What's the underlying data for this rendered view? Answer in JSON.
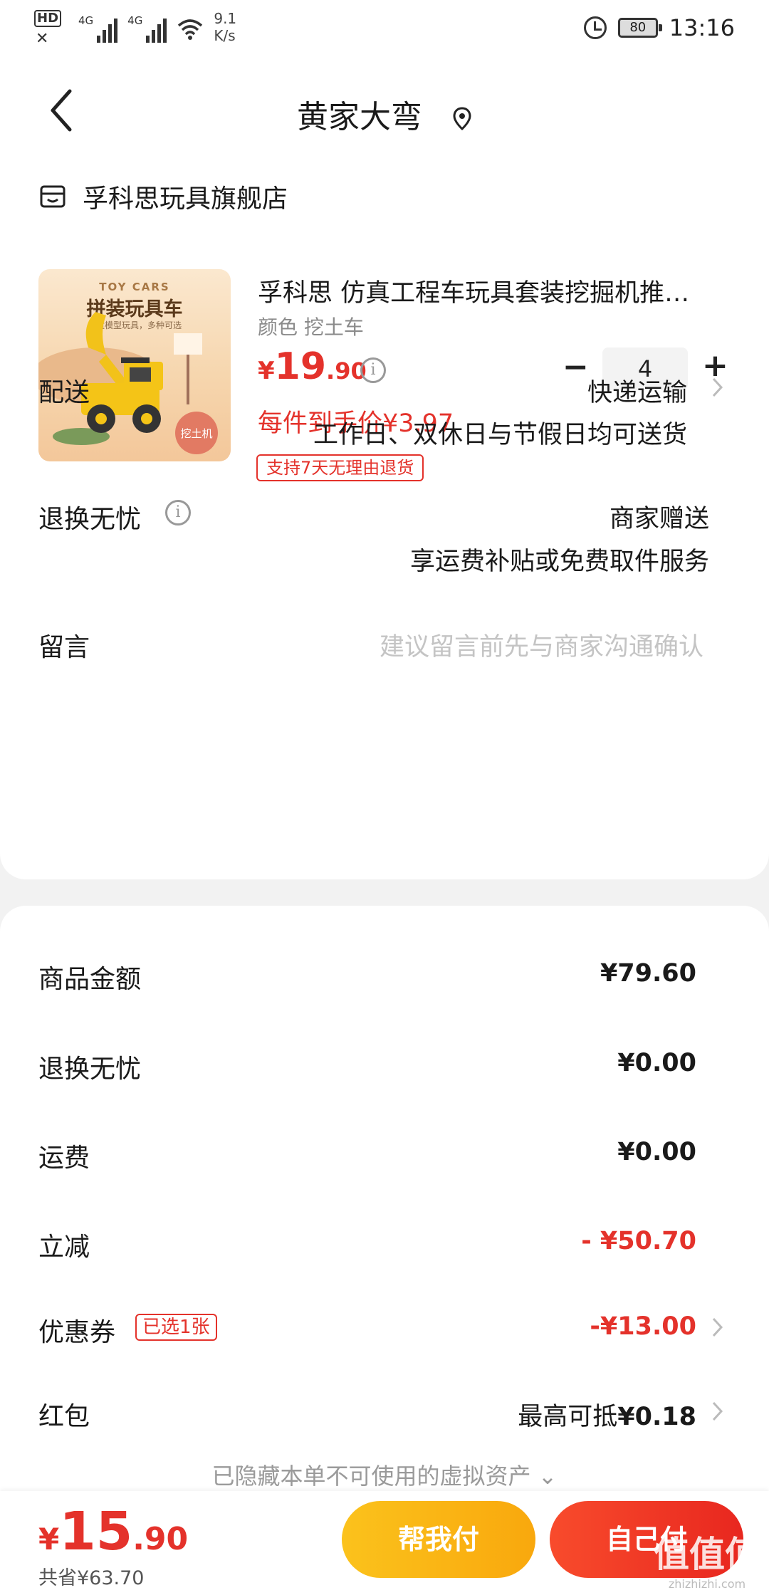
{
  "status_bar": {
    "hd": "HD",
    "sim1": "1",
    "sim2": "2",
    "net1": "4G",
    "net2": "4G",
    "speed_value": "9.1",
    "speed_unit": "K/s",
    "battery": "80",
    "time": "13:16"
  },
  "header": {
    "title": "黄家大弯"
  },
  "shop": {
    "name": "孚科思玩具旗舰店"
  },
  "product": {
    "thumb_tagline": "TOY CARS",
    "thumb_title": "拼装玩具车",
    "thumb_sub": "儿童模型玩具，多种可选",
    "thumb_tag": "挖土机",
    "name": "孚科思 仿真工程车玩具套装挖掘机推…",
    "spec": "颜色 挖土车",
    "price_currency": "¥",
    "price_int": "19",
    "price_dec": ".90",
    "quantity": "4",
    "unit_price": "每件到手价¥3.97",
    "return_badge": "支持7天无理由退货"
  },
  "delivery": {
    "label": "配送",
    "method": "快递运输",
    "note": "工作日、双休日与节假日均可送货"
  },
  "returns": {
    "label": "退换无忧",
    "value": "商家赠送",
    "note": "享运费补贴或免费取件服务"
  },
  "message": {
    "label": "留言",
    "placeholder": "建议留言前先与商家沟通确认"
  },
  "fees": {
    "goods_label": "商品金额",
    "goods_value": "¥79.60",
    "returns_label": "退换无忧",
    "returns_value": "¥0.00",
    "shipping_label": "运费",
    "shipping_value": "¥0.00",
    "discount_label": "立减",
    "discount_value": "- ¥50.70",
    "coupon_label": "优惠券",
    "coupon_badge": "已选1张",
    "coupon_value": "-¥13.00",
    "redpacket_label": "红包",
    "redpacket_prefix": "最高可抵",
    "redpacket_value": "¥0.18",
    "hidden_note": "已隐藏本单不可使用的虚拟资产 ⌄"
  },
  "bottom_bar": {
    "total_currency": "¥",
    "total_int": "15",
    "total_dec": ".90",
    "saved": "共省¥63.70",
    "help_pay": "帮我付",
    "self_pay": "自己付"
  },
  "watermark": {
    "text": "值",
    "site": "zhizhizhi.com"
  },
  "colors": {
    "accent_red": "#e4322b",
    "accent_yellow": "#fbc21c"
  }
}
